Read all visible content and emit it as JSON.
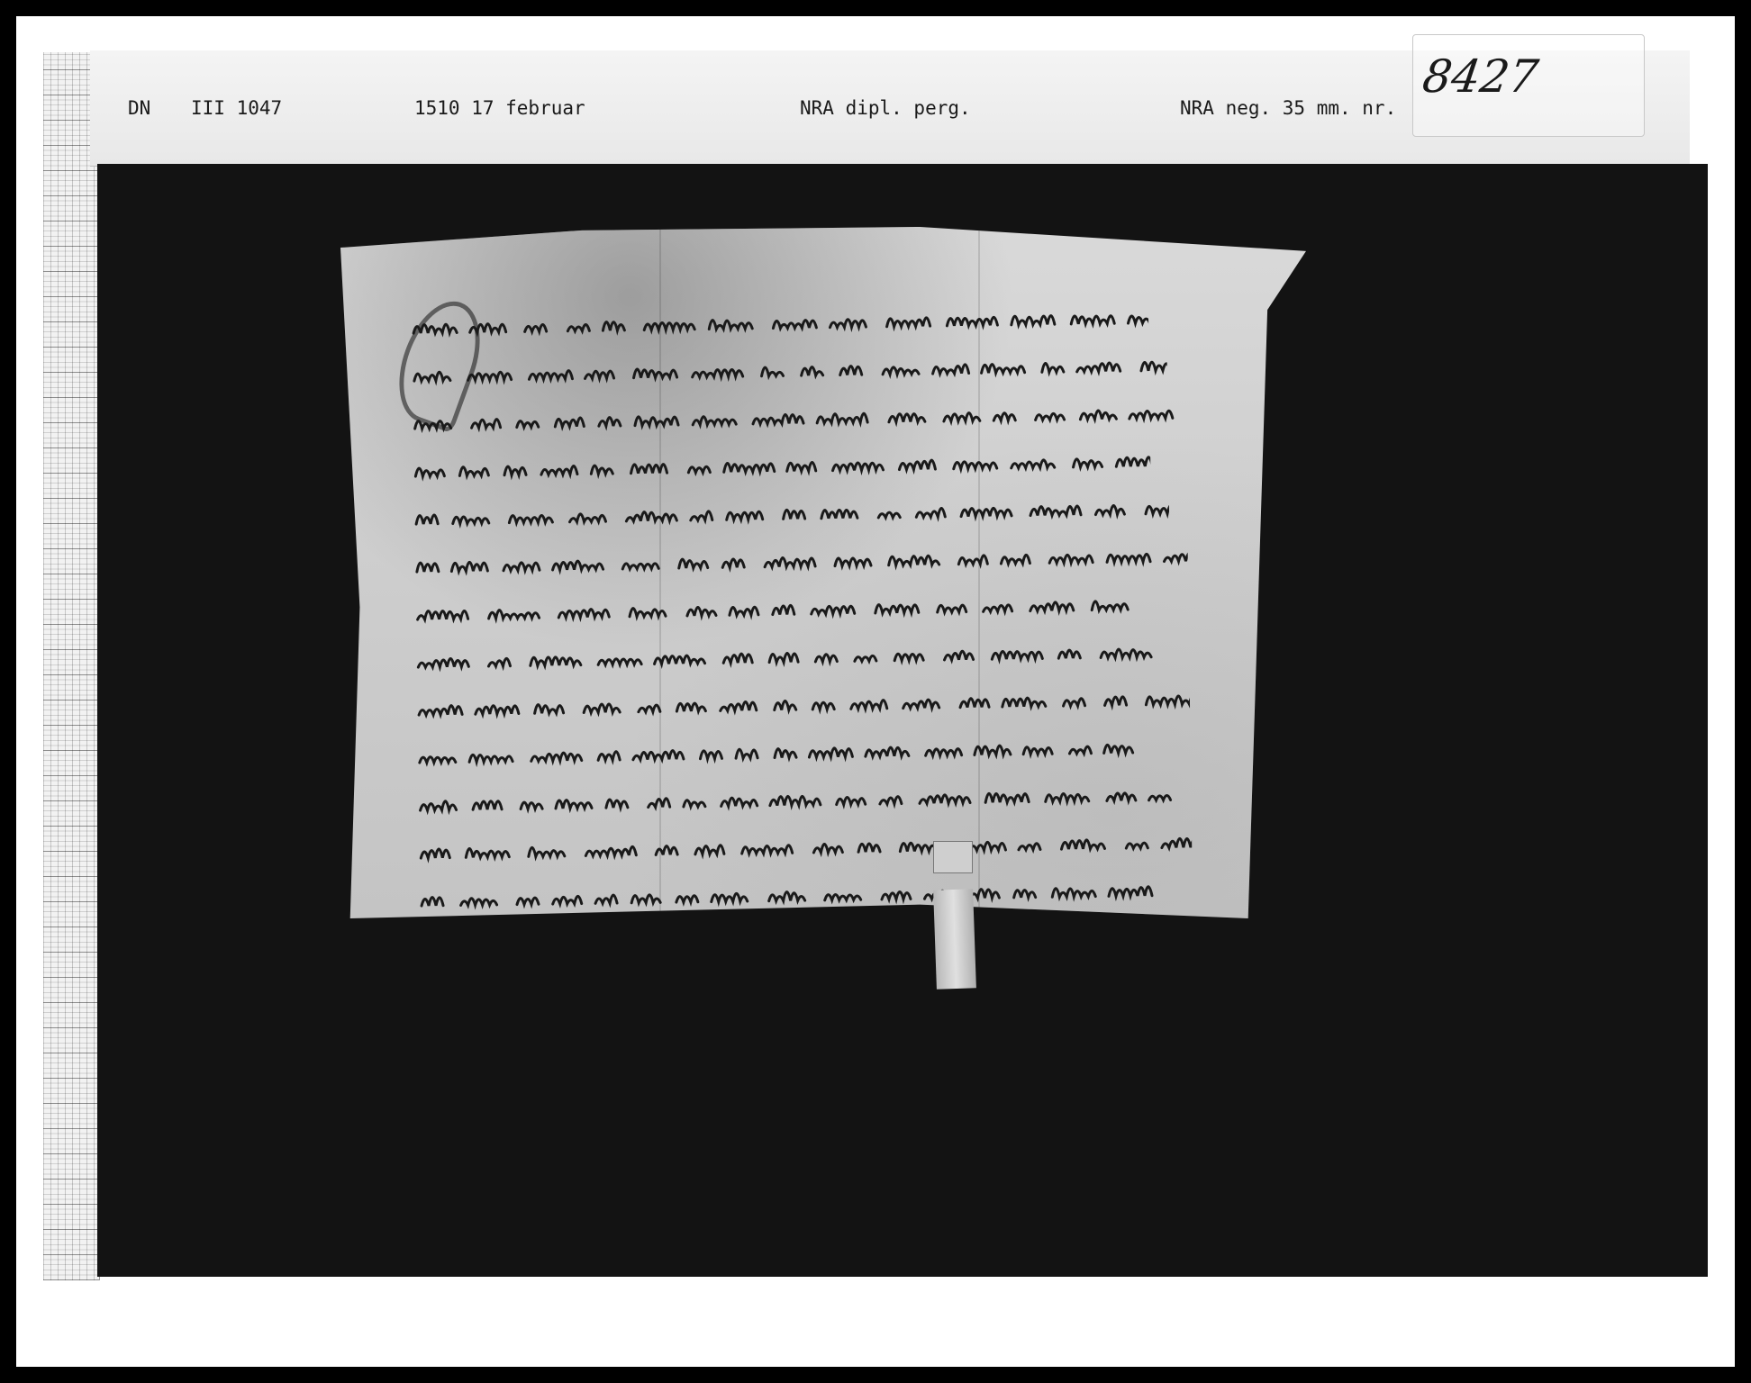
{
  "label": {
    "collection": "DN",
    "volume_number": "III 1047",
    "date": "1510  17 februar",
    "archive": "NRA dipl. perg.",
    "negative": "NRA neg. 35 mm. nr.",
    "handwritten_number": "8427"
  }
}
